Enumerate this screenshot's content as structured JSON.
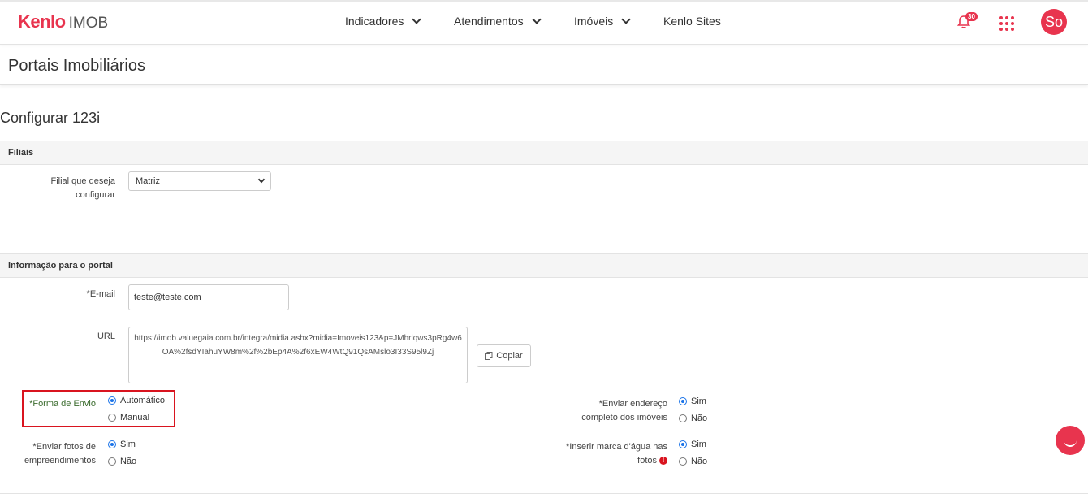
{
  "brand": {
    "name": "Kenlo",
    "product": "IMOB",
    "accent": "#e8344e"
  },
  "nav": {
    "items": [
      {
        "label": "Indicadores",
        "has_menu": true
      },
      {
        "label": "Atendimentos",
        "has_menu": true
      },
      {
        "label": "Imóveis",
        "has_menu": true
      },
      {
        "label": "Kenlo Sites",
        "has_menu": false
      }
    ],
    "notifications_count": "30",
    "avatar_initials": "So"
  },
  "page": {
    "title": "Portais Imobiliários",
    "subtitle": "Configurar 123i"
  },
  "sections": {
    "filiais": {
      "title": "Filiais",
      "branch_label": "Filial que deseja configurar",
      "branch_value": "Matriz"
    },
    "portal_info": {
      "title": "Informação para o portal",
      "email_label": "*E-mail",
      "email_value": "teste@teste.com",
      "url_label": "URL",
      "url_value": "https://imob.valuegaia.com.br/integra/midia.ashx?midia=Imoveis123&p=JMhrlqws3pRg4w6OA%2fsdYIahuYW8m%2f%2bEp4A%2f6xEW4WtQ91QsAMslo3I33S95l9Zj",
      "copy_label": "Copiar",
      "forma_envio": {
        "label": "*Forma de Envio",
        "options": [
          "Automático",
          "Manual"
        ],
        "selected": "Automático"
      },
      "enviar_fotos": {
        "label": "*Enviar fotos de empreendimentos",
        "options": [
          "Sim",
          "Não"
        ],
        "selected": "Sim"
      },
      "enviar_endereco": {
        "label": "*Enviar endereço completo dos imóveis",
        "options": [
          "Sim",
          "Não"
        ],
        "selected": "Sim"
      },
      "marca_agua": {
        "label": "*Inserir marca d'água nas fotos",
        "options": [
          "Sim",
          "Não"
        ],
        "selected": "Sim"
      }
    }
  }
}
